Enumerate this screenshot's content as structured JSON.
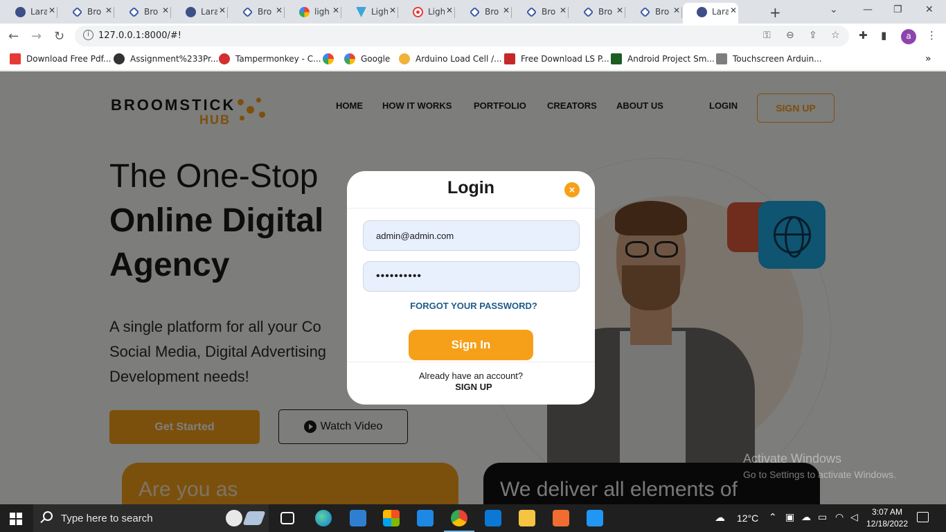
{
  "browser": {
    "tabs": [
      {
        "title": "Lara",
        "icon": "globe-icon"
      },
      {
        "title": "Bro",
        "icon": "broomstick-icon"
      },
      {
        "title": "Bro",
        "icon": "broomstick-icon"
      },
      {
        "title": "Lara",
        "icon": "globe-icon"
      },
      {
        "title": "Bro",
        "icon": "broomstick-icon"
      },
      {
        "title": "ligh",
        "icon": "google-icon"
      },
      {
        "title": "Ligh",
        "icon": "vuetify-icon"
      },
      {
        "title": "Ligh",
        "icon": "record-icon"
      },
      {
        "title": "Bro",
        "icon": "broomstick-icon"
      },
      {
        "title": "Bro",
        "icon": "broomstick-icon"
      },
      {
        "title": "Bro",
        "icon": "broomstick-icon"
      },
      {
        "title": "Bro",
        "icon": "broomstick-icon"
      },
      {
        "title": "Lara",
        "icon": "globe-icon",
        "active": true
      }
    ],
    "url": "127.0.0.1:8000/#!",
    "profile_initial": "a",
    "bookmarks": [
      "Download Free Pdf...",
      "Assignment%233Pr...",
      "Tampermonkey - C...",
      "",
      "Google",
      "Arduino Load Cell /...",
      "Free Download LS P...",
      "Android Project Sm...",
      "Touchscreen Arduin..."
    ]
  },
  "site": {
    "logo_line1": "BROOMSTICK",
    "logo_line2": "HUB",
    "nav": [
      "HOME",
      "HOW IT WORKS",
      "PORTFOLIO",
      "CREATORS",
      "ABOUT US"
    ],
    "login": "LOGIN",
    "signup": "SIGN UP",
    "headline1": "The One-Stop",
    "headline2": "Online Digital",
    "headline3": "Agency",
    "sub1": "A single platform for all your Co",
    "sub2": "Social Media, Digital Advertising",
    "sub3": "Development needs!",
    "get_started": "Get Started",
    "watch_video": "Watch Video",
    "card1": "Are you as",
    "card2": "We deliver all elements of",
    "accent": "#f6a01a"
  },
  "modal": {
    "title": "Login",
    "close": "×",
    "email_value": "admin@admin.com",
    "password_value": "••••••••••",
    "forgot": "FORGOT YOUR PASSWORD?",
    "signin": "Sign In",
    "already": "Already have an account?",
    "signup": "SIGN UP"
  },
  "watermark": {
    "line1": "Activate Windows",
    "line2": "Go to Settings to activate Windows."
  },
  "taskbar": {
    "search_placeholder": "Type here to search",
    "temperature": "12°C",
    "time": "3:07 AM",
    "date": "12/18/2022"
  }
}
